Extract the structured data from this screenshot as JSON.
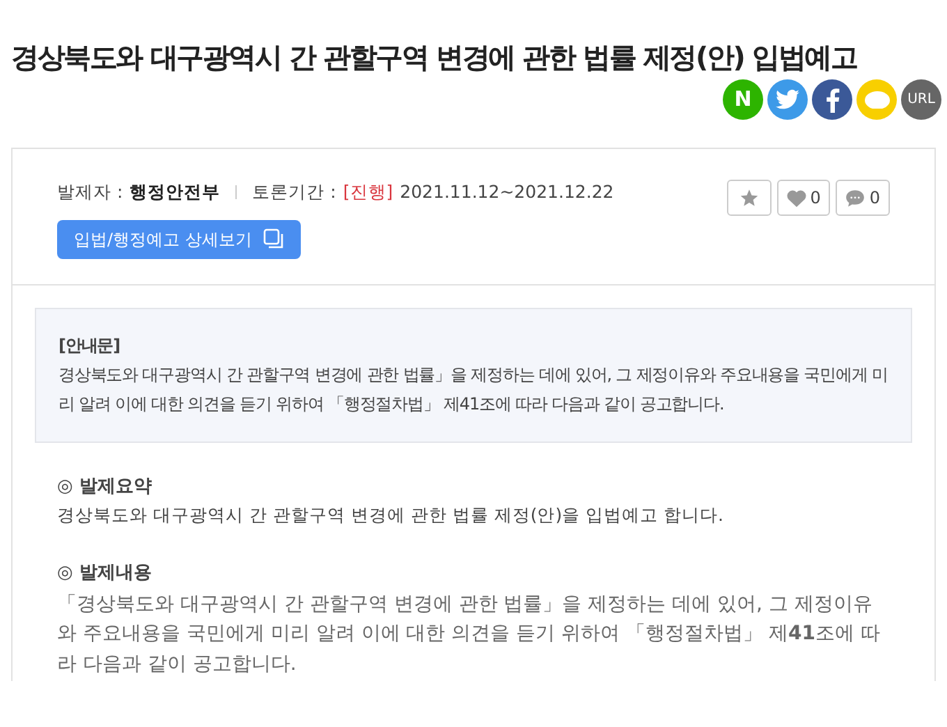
{
  "title": "경상북도와 대구광역시 간 관할구역 변경에 관한 법률 제정(안) 입법예고",
  "share": [
    {
      "kind": "naver",
      "label": "N"
    },
    {
      "kind": "twitter"
    },
    {
      "kind": "facebook"
    },
    {
      "kind": "kakao"
    },
    {
      "kind": "url",
      "label": "URL"
    }
  ],
  "meta": {
    "proposer_label": "발제자 :",
    "proposer": "행정안전부",
    "period_label": "토론기간 :",
    "status": "[진행]",
    "period": "2021.11.12~2021.12.22"
  },
  "detail_button": "입법/행정예고 상세보기",
  "actions": [
    {
      "kind": "star"
    },
    {
      "kind": "like",
      "count": "0"
    },
    {
      "kind": "comment",
      "count": "0"
    }
  ],
  "notice": {
    "heading": "[안내문]",
    "text": "경상북도와 대구광역시 간 관할구역 변경에 관한 법률」을 제정하는 데에 있어, 그 제정이유와 주요내용을 국민에게 미리 알려 이에 대한 의견을 듣기 위하여 「행정절차법」 제41조에 따라 다음과 같이 공고합니다."
  },
  "sections": [
    {
      "heading": "◎ 발제요약",
      "text": "경상북도와 대구광역시 간 관할구역 변경에 관한 법률 제정(안)을 입법예고 합니다.",
      "kind": "summary"
    },
    {
      "heading": "◎ 발제내용",
      "text": "「경상북도와 대구광역시 간 관할구역 변경에 관한 법률」을 제정하는 데에 있어, 그 제정이유와 주요내용을 국민에게 미리 알려 이에 대한 의견을 듣기 위하여 「행정절차법」 제**41**조에 따라 다음과 같이 공고합니다.",
      "kind": "body"
    }
  ]
}
